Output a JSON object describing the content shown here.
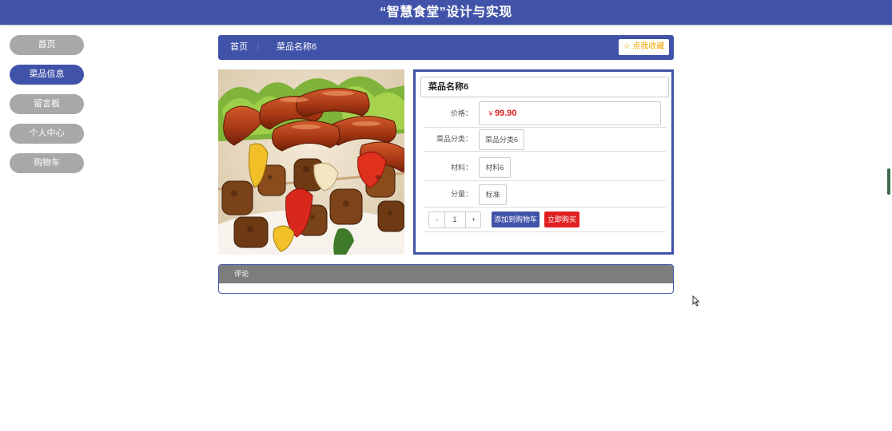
{
  "header": {
    "title": "“智慧食堂”设计与实现"
  },
  "sidebar": {
    "items": [
      {
        "label": "首页"
      },
      {
        "label": "菜品信息"
      },
      {
        "label": "留言板"
      },
      {
        "label": "个人中心"
      },
      {
        "label": "购物车"
      }
    ]
  },
  "breadcrumb": {
    "home": "首页",
    "separator": "/",
    "current": "菜品名称6",
    "favorite_label": "☆ 点我收藏",
    "favorite_icon": "star-outline-icon"
  },
  "product": {
    "image": "grilled-sausage-kebab-photo",
    "name": "菜品名称6",
    "price_label": "价格：",
    "currency": "￥",
    "price": "99.90",
    "category_label": "菜品分类：",
    "category": "菜品分类6",
    "material_label": "材料：",
    "material": "材料6",
    "portion_label": "分量：",
    "portion": "标准",
    "quantity": "1",
    "minus": "-",
    "plus": "+",
    "add_to_cart": "添加到购物车",
    "buy_now": "立即购买"
  },
  "comments": {
    "title": "评论"
  },
  "colors": {
    "primary": "#4153a8",
    "danger": "#e02020",
    "sidebar_inactive": "#a8a8a8",
    "favorite_text": "#f0a800",
    "comment_header": "#7d7d7d"
  }
}
